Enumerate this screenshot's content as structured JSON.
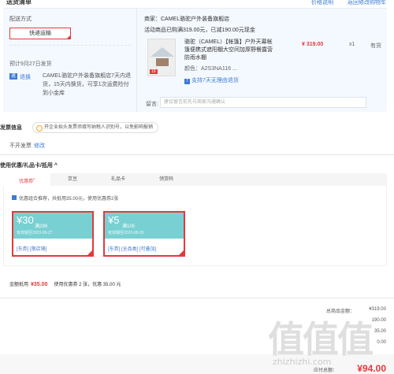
{
  "header": {
    "title": "送货清单",
    "link1": "价格说明",
    "link2": "返回修改购物车"
  },
  "shipping": {
    "method_label": "配送方式",
    "method_button": "快递运输",
    "date_label": "预计9月27日发货",
    "tag": "退",
    "tag_text": "退换",
    "note": "CAMEL骆驼户外装备旗舰店7天内退货，15天内换货，可享1次运费险付到小金库"
  },
  "order": {
    "shop": "商家：CAMEL骆驼户外装备旗舰店",
    "promo": "活动商品已购满319.00元，已减190.00元现金",
    "product_name": "骆驼（CAMEL）【帐篷】户外天幕帐篷便携式遮阳棚大空间加厚野餐露营防雨水棚",
    "color": "颜色：A2S3NA116 ...",
    "price": "¥ 319.00",
    "qty": "x1",
    "stock": "有货",
    "return": "支持7天无理由退货",
    "return_icon": "7",
    "thumb_badge": "19",
    "memo_label": "留言:",
    "memo_placeholder": "建议留言前先与商家沟通确认"
  },
  "invoice": {
    "title": "发票信息",
    "tip": "开企业抬头发票须填写纳税人识别号，以免影响报销",
    "value": "不开发票",
    "edit": "修改"
  },
  "coupons": {
    "title": "使用优惠/礼品卡/抵用 ^",
    "tabs": [
      {
        "label": "优惠券",
        "sup": "•"
      },
      {
        "label": "京豆"
      },
      {
        "label": "礼品卡"
      },
      {
        "label": "领货码"
      }
    ],
    "combo_text": "优惠组合推荐，共抵用35.00元，使用优惠券2张",
    "cards": [
      {
        "amount": "¥30",
        "cond": "满299",
        "exp": "有效期至2023-09-27",
        "foot": "[东券] [限店铺]"
      },
      {
        "amount": "¥5",
        "cond": "满105",
        "exp": "有效期至2023-09-25",
        "foot": "[东券] [全品类] [可叠加]"
      }
    ],
    "total_label": "金额抵用",
    "total_value": "¥35.00",
    "total_detail": "使用优惠券 2 张，优惠 35.00 元"
  },
  "summary": {
    "row1_label": "总商品金额：",
    "row1_value": "¥319.00",
    "row2_value": "190.00",
    "row3_value": "35.00",
    "row4_value": "0.00",
    "grand_label": "应付总额：",
    "grand_value": "¥94.00"
  },
  "watermark": {
    "text": "值值值",
    "url": "zhizhizhi.com"
  }
}
